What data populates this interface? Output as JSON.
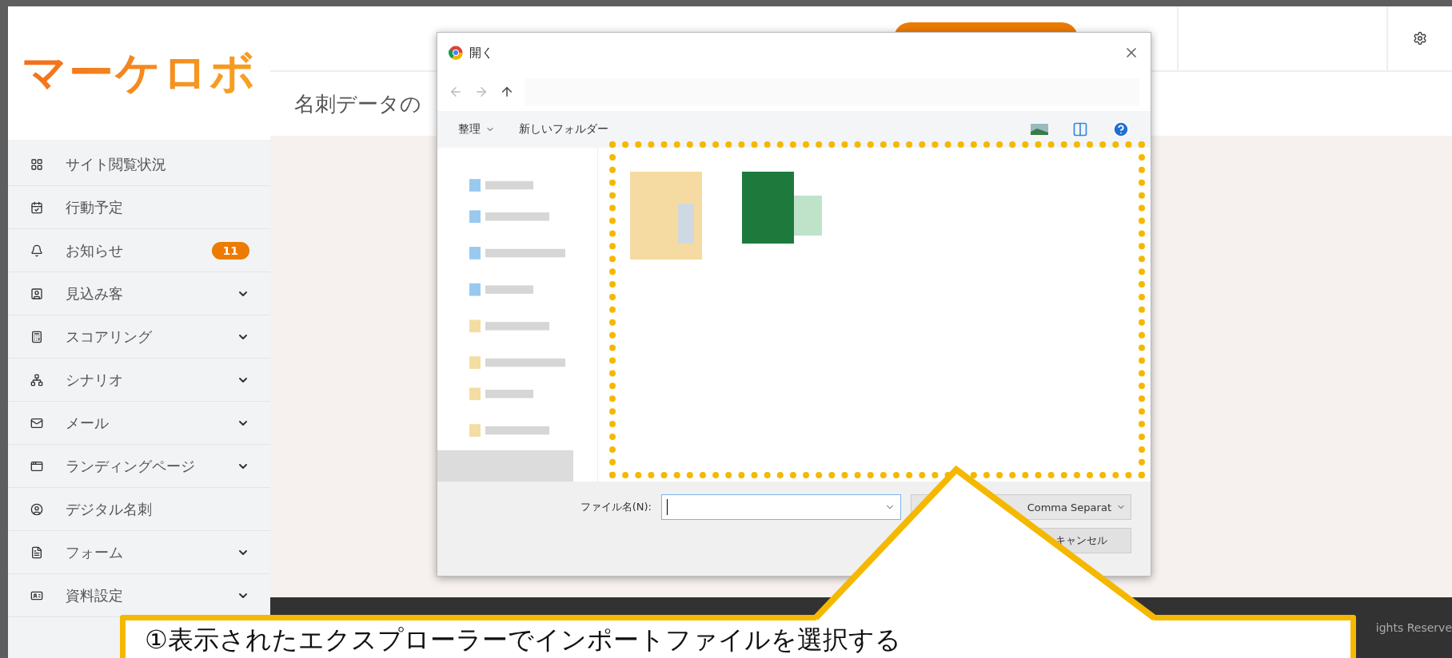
{
  "logo": "マーケロボ",
  "sidebar": {
    "items": [
      {
        "label": "サイト閲覧状況",
        "expandable": false
      },
      {
        "label": "行動予定",
        "expandable": false
      },
      {
        "label": "お知らせ",
        "expandable": false,
        "badge": "11"
      },
      {
        "label": "見込み客",
        "expandable": true
      },
      {
        "label": "スコアリング",
        "expandable": true
      },
      {
        "label": "シナリオ",
        "expandable": true
      },
      {
        "label": "メール",
        "expandable": true
      },
      {
        "label": "ランディングページ",
        "expandable": true
      },
      {
        "label": "デジタル名刺",
        "expandable": false
      },
      {
        "label": "フォーム",
        "expandable": true
      },
      {
        "label": "資料設定",
        "expandable": true
      }
    ]
  },
  "page": {
    "title": "名刺データの"
  },
  "footer": {
    "copyright": "ights Reserve"
  },
  "dialog": {
    "title": "開く",
    "organize": "整理",
    "new_folder": "新しいフォルダー",
    "filename_label": "ファイル名(N):",
    "filetype": "Comma Separat",
    "cancel": "キャンセル"
  },
  "callout": {
    "text": "①表示されたエクスプローラーでインポートファイルを選択する"
  }
}
